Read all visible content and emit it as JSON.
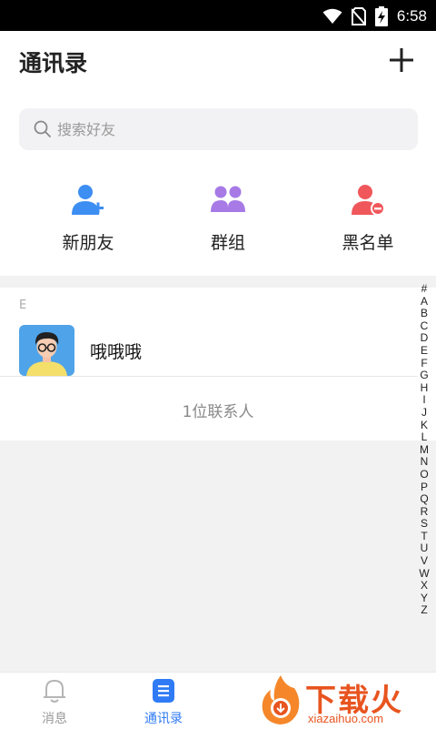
{
  "status_bar": {
    "time": "6:58"
  },
  "header": {
    "title": "通讯录"
  },
  "search": {
    "placeholder": "搜索好友"
  },
  "quick_actions": [
    {
      "label": "新朋友",
      "icon": "new-friend-icon",
      "color": "#3d8ef2"
    },
    {
      "label": "群组",
      "icon": "group-icon",
      "color": "#a77ae6"
    },
    {
      "label": "黑名单",
      "icon": "blacklist-icon",
      "color": "#f0575b"
    }
  ],
  "contacts": {
    "section": "E",
    "items": [
      {
        "name": "哦哦哦"
      }
    ],
    "count_text": "1位联系人"
  },
  "index_letters": [
    "#",
    "A",
    "B",
    "C",
    "D",
    "E",
    "F",
    "G",
    "H",
    "I",
    "J",
    "K",
    "L",
    "M",
    "N",
    "O",
    "P",
    "Q",
    "R",
    "S",
    "T",
    "U",
    "V",
    "W",
    "X",
    "Y",
    "Z"
  ],
  "tabs": [
    {
      "label": "消息",
      "icon": "bell-icon",
      "active": false
    },
    {
      "label": "通讯录",
      "icon": "contacts-icon",
      "active": true
    }
  ],
  "watermark": {
    "title": "下载火",
    "subtitle": "xiazaihuo.com"
  },
  "colors": {
    "accent": "#2f7bf5",
    "brand_watermark": "#e8541f"
  }
}
